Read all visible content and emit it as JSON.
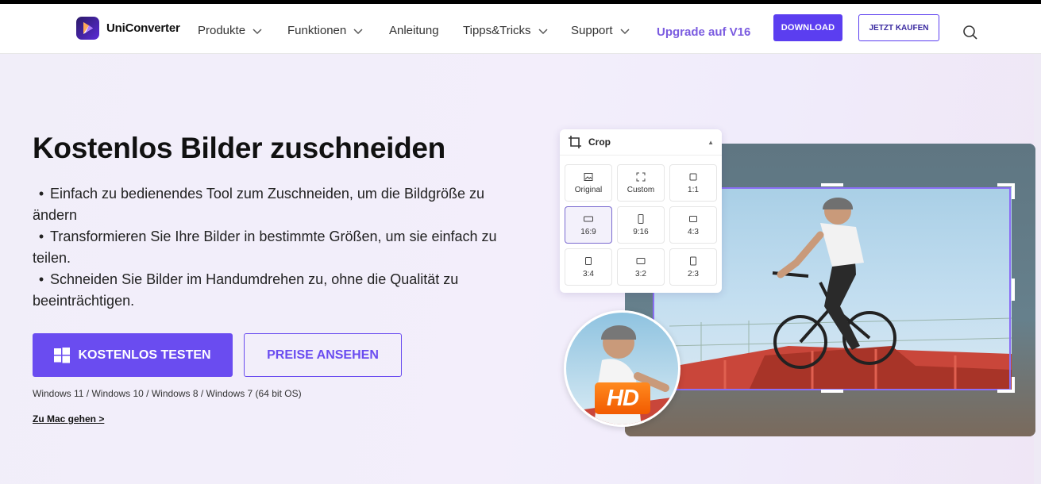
{
  "header": {
    "logo_text": "UniConverter",
    "nav": [
      {
        "label": "Produkte",
        "has_dropdown": true
      },
      {
        "label": "Funktionen",
        "has_dropdown": true
      },
      {
        "label": "Anleitung",
        "has_dropdown": false
      },
      {
        "label": "Tipps&Tricks",
        "has_dropdown": true
      },
      {
        "label": "Support",
        "has_dropdown": true
      }
    ],
    "upgrade_label": "Upgrade auf V16",
    "download_label": "DOWNLOAD",
    "buy_label": "JETZT KAUFEN"
  },
  "hero": {
    "title": "Kostenlos Bilder zuschneiden",
    "bullets": [
      "Einfach zu bedienendes Tool zum Zuschneiden, um die Bildgröße zu ändern",
      "Transformieren Sie Ihre Bilder in bestimmte Größen, um sie einfach zu teilen.",
      "Schneiden Sie Bilder im Handumdrehen zu, ohne die Qualität zu beeinträchtigen."
    ],
    "bullet_char": "•",
    "try_label": "KOSTENLOS TESTEN",
    "price_label": "PREISE ANSEHEN",
    "os_note": "Windows 11 / Windows 10 / Windows 8 / Windows 7 (64 bit OS)",
    "mac_link": "Zu Mac gehen >"
  },
  "crop_panel": {
    "title": "Crop",
    "options": [
      {
        "label": "Original",
        "icon": "image-icon",
        "selected": false
      },
      {
        "label": "Custom",
        "icon": "custom-frame-icon",
        "selected": false
      },
      {
        "label": "1:1",
        "icon": "square-icon",
        "selected": false
      },
      {
        "label": "16:9",
        "icon": "wide-rect-icon",
        "selected": true
      },
      {
        "label": "9:16",
        "icon": "tall-rect-icon",
        "selected": false
      },
      {
        "label": "4:3",
        "icon": "rect-icon",
        "selected": false
      },
      {
        "label": "3:4",
        "icon": "rect-icon",
        "selected": false
      },
      {
        "label": "3:2",
        "icon": "rect-icon",
        "selected": false
      },
      {
        "label": "2:3",
        "icon": "rect-icon",
        "selected": false
      }
    ]
  },
  "badge": {
    "label": "HD"
  },
  "colors": {
    "accent": "#5b3ef0",
    "button": "#6a4cf0",
    "upgrade": "#7b5ce0",
    "hd": "#f25a00"
  }
}
